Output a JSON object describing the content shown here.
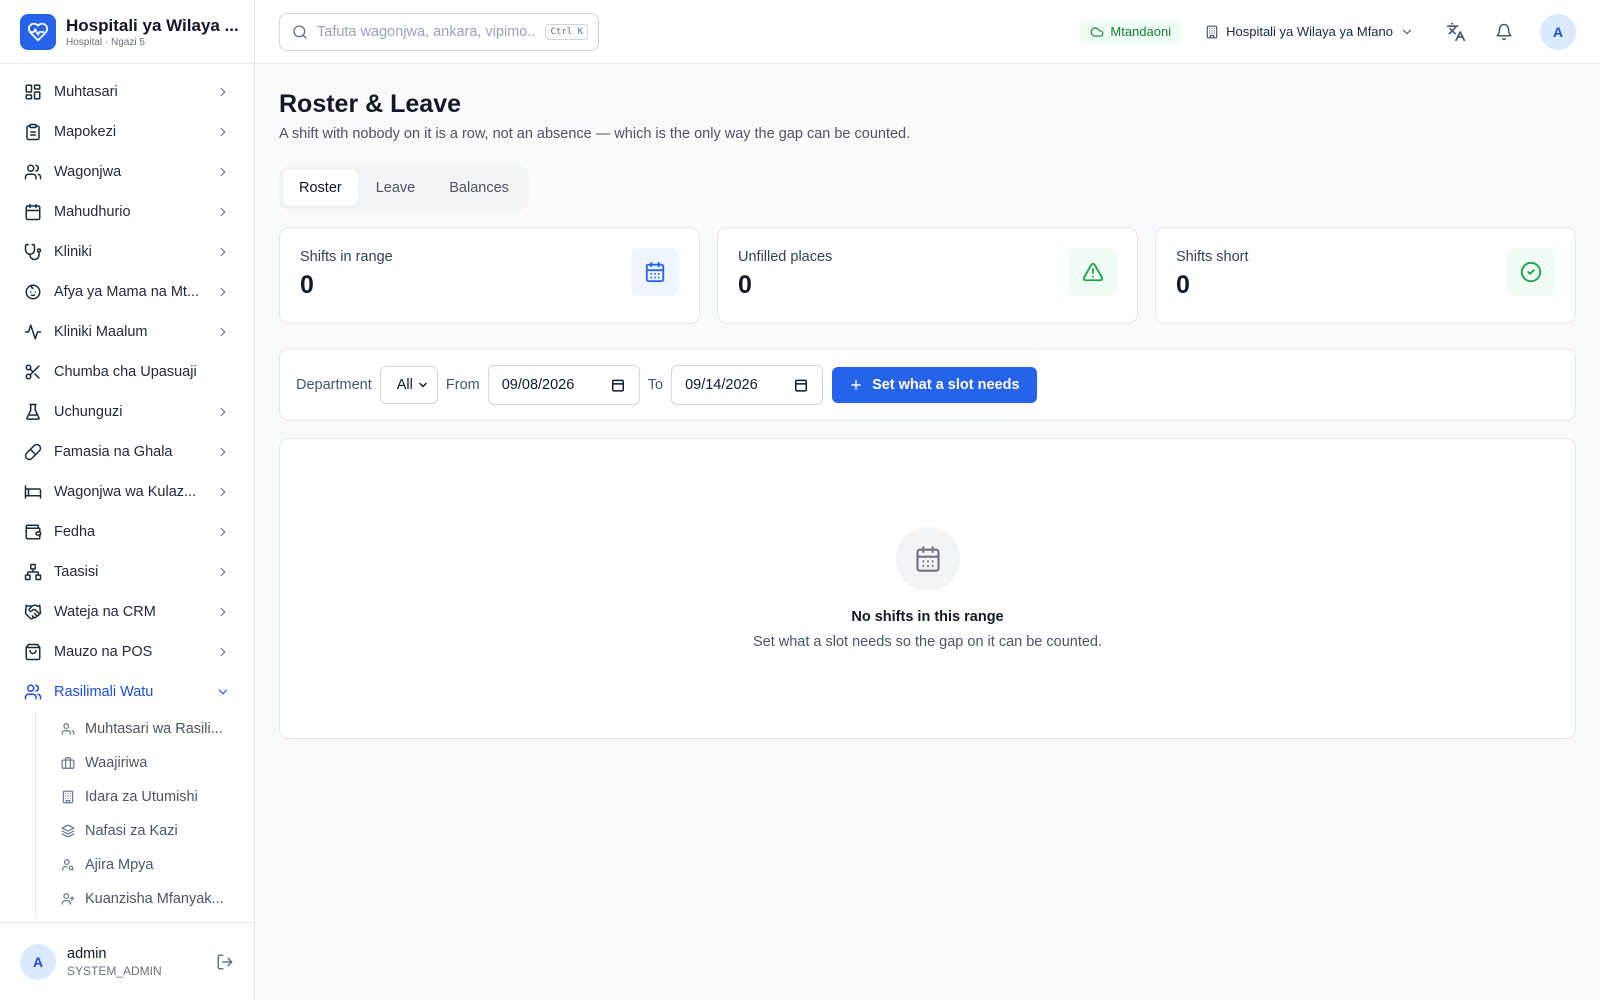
{
  "brand": {
    "title": "Hospitali ya Wilaya ...",
    "subtitle": "Hospital · Ngazi 5",
    "color": "#2563eb"
  },
  "sidebar": {
    "items": [
      {
        "label": "Muhtasari",
        "icon": "dashboard-icon"
      },
      {
        "label": "Mapokezi",
        "icon": "clipboard-icon"
      },
      {
        "label": "Wagonjwa",
        "icon": "users-icon"
      },
      {
        "label": "Mahudhurio",
        "icon": "calendar-icon"
      },
      {
        "label": "Kliniki",
        "icon": "stethoscope-icon"
      },
      {
        "label": "Afya ya Mama na Mt...",
        "icon": "baby-icon"
      },
      {
        "label": "Kliniki Maalum",
        "icon": "activity-icon"
      },
      {
        "label": "Chumba cha Upasuaji",
        "icon": "scissors-icon"
      },
      {
        "label": "Uchunguzi",
        "icon": "flask-icon"
      },
      {
        "label": "Famasia na Ghala",
        "icon": "pill-icon"
      },
      {
        "label": "Wagonjwa wa Kulaz...",
        "icon": "bed-icon"
      },
      {
        "label": "Fedha",
        "icon": "wallet-icon"
      },
      {
        "label": "Taasisi",
        "icon": "network-icon"
      },
      {
        "label": "Wateja na CRM",
        "icon": "handshake-icon"
      },
      {
        "label": "Mauzo na POS",
        "icon": "shopping-bag-icon"
      },
      {
        "label": "Rasilimali Watu",
        "icon": "users-icon"
      }
    ],
    "subitems": [
      {
        "label": "Muhtasari wa Rasili...",
        "icon": "users-icon"
      },
      {
        "label": "Waajiriwa",
        "icon": "briefcase-icon"
      },
      {
        "label": "Idara za Utumishi",
        "icon": "building-icon"
      },
      {
        "label": "Nafasi za Kazi",
        "icon": "layers-icon"
      },
      {
        "label": "Ajira Mpya",
        "icon": "user-search-icon"
      },
      {
        "label": "Kuanzisha Mfanyak...",
        "icon": "user-plus-icon"
      }
    ]
  },
  "user": {
    "avatar": "A",
    "name": "admin",
    "role": "SYSTEM_ADMIN"
  },
  "topbar": {
    "search_placeholder": "Tafuta wagonjwa, ankara, vipimo...",
    "shortcut": "Ctrl K",
    "status": "Mtandaoni",
    "facility": "Hospitali ya Wilaya ya Mfano",
    "avatar": "A"
  },
  "page": {
    "title": "Roster & Leave",
    "subtitle": "A shift with nobody on it is a row, not an absence — which is the only way the gap can be counted."
  },
  "tabs": [
    "Roster",
    "Leave",
    "Balances"
  ],
  "stats": [
    {
      "label": "Shifts in range",
      "value": "0",
      "icon": "calendar-icon"
    },
    {
      "label": "Unfilled places",
      "value": "0",
      "icon": "warning-icon"
    },
    {
      "label": "Shifts short",
      "value": "0",
      "icon": "check-circle-icon"
    }
  ],
  "filters": {
    "department_label": "Department",
    "department_value": "All",
    "from_label": "From",
    "from_value": "09/08/2026",
    "to_label": "To",
    "to_value": "09/14/2026",
    "button_label": "Set what a slot needs"
  },
  "empty": {
    "title": "No shifts in this range",
    "text": "Set what a slot needs so the gap on it can be counted."
  }
}
